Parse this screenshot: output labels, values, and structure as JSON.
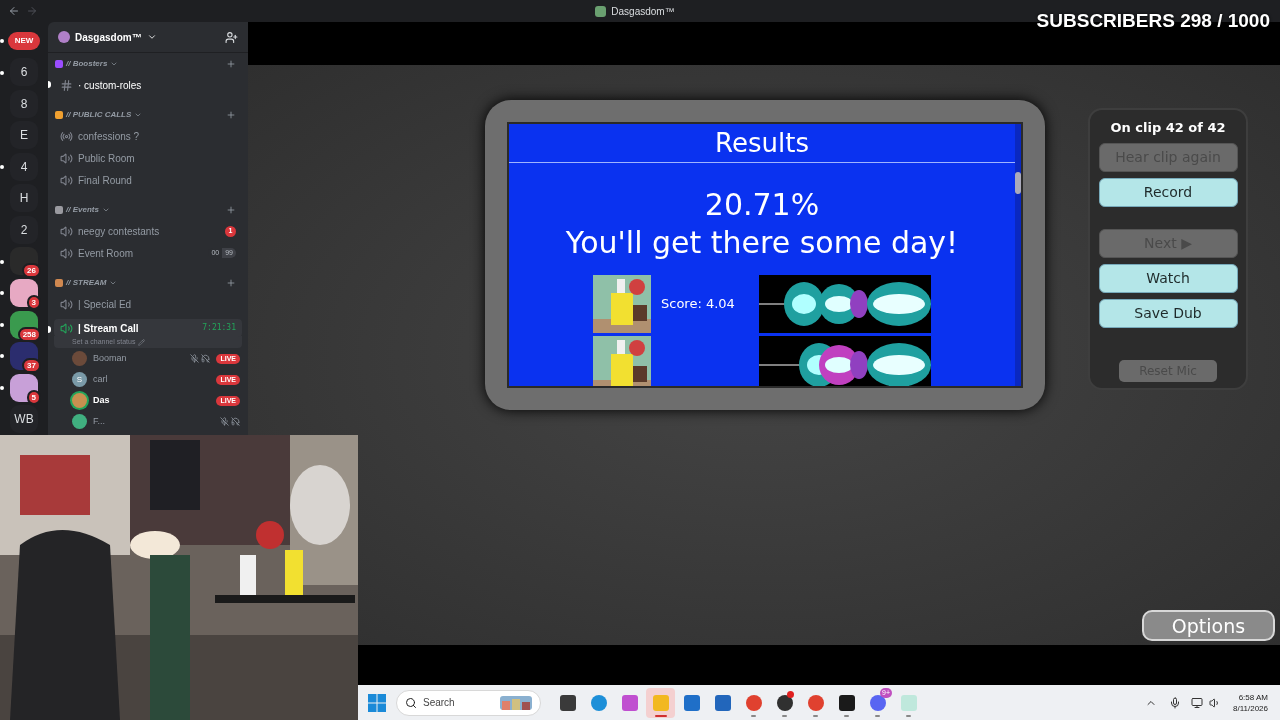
{
  "window": {
    "title": "Dasgasdom™"
  },
  "overlay": {
    "subscribers": "SUBSCRIBERS 298 / 1000"
  },
  "servers": [
    {
      "kind": "pill",
      "label": "NEW",
      "unread": true
    },
    {
      "kind": "letter",
      "label": "6",
      "unread": true
    },
    {
      "kind": "letter",
      "label": "8",
      "unread": false
    },
    {
      "kind": "letter",
      "label": "E",
      "unread": false
    },
    {
      "kind": "letter",
      "label": "4",
      "unread": true
    },
    {
      "kind": "letter",
      "label": "H",
      "unread": false
    },
    {
      "kind": "letter",
      "label": "2",
      "unread": false
    },
    {
      "kind": "avatar",
      "count": "26",
      "color": "#2a2a2a",
      "unread": true
    },
    {
      "kind": "avatar",
      "count": "3",
      "color": "#e7a9c3",
      "unread": true
    },
    {
      "kind": "avatar",
      "count": "258",
      "color": "#3a9a4e",
      "unread": true
    },
    {
      "kind": "avatar",
      "count": "37",
      "color": "#2b2d6e",
      "unread": true
    },
    {
      "kind": "avatar",
      "count": "5",
      "color": "#c8a0d8",
      "unread": true
    },
    {
      "kind": "letter",
      "label": "WB",
      "unread": false
    }
  ],
  "channel_list": {
    "server_name": "Dasgasdom™",
    "categories": [
      {
        "name": "// Boosters",
        "color": "#9b4dff",
        "channels": [
          {
            "kind": "text",
            "name": "· custom-roles",
            "unread": true,
            "selected": false
          }
        ]
      },
      {
        "name": "// PUBLIC CALLS",
        "color": "#f0a030",
        "channels": [
          {
            "kind": "stage",
            "name": "confessions ?",
            "unread": false,
            "selected": false
          },
          {
            "kind": "voice",
            "name": "Public Room",
            "unread": false,
            "selected": false
          },
          {
            "kind": "voice",
            "name": "Final Round",
            "unread": false,
            "selected": false
          }
        ]
      },
      {
        "name": "// Events",
        "color": "#9a9aa0",
        "channels": [
          {
            "kind": "voice",
            "name": "neegy contestants",
            "badge": "1",
            "unread": false,
            "selected": false
          },
          {
            "kind": "voice",
            "name": "Event Room",
            "limit": [
              "00",
              "99"
            ],
            "unread": false,
            "selected": false
          }
        ]
      },
      {
        "name": "// STREAM",
        "color": "#d08850",
        "channels": [
          {
            "kind": "voice",
            "name": "| Special Ed",
            "unread": false,
            "selected": false
          },
          {
            "kind": "voice",
            "name": "| Stream Call",
            "timer": "7:21:31",
            "status": "Set a channel status",
            "unread": true,
            "selected": true,
            "members": [
              {
                "name": "Booman",
                "color": "#6b4a3a",
                "badge": "LIVE",
                "muted": true,
                "speaking": false
              },
              {
                "name": "carl",
                "color": "#7a9aa8",
                "letter": "S",
                "badge": "LIVE",
                "muted": false,
                "speaking": false
              },
              {
                "name": "Das",
                "color": "#c89050",
                "badge": "LIVE",
                "muted": false,
                "speaking": true
              },
              {
                "name": "F...",
                "color": "#40b080",
                "muted": true,
                "speaking": false
              }
            ]
          }
        ]
      }
    ]
  },
  "results": {
    "title": "Results",
    "score": "20.71%",
    "message": "You'll get there some day!",
    "clips": [
      {
        "kind": "scored",
        "score": "Score: 4.04"
      },
      {
        "kind": "partial"
      }
    ]
  },
  "controls": {
    "clip_counter": "On clip 42 of 42",
    "button_groups": [
      [
        {
          "label": "Hear clip again",
          "disabled": true
        },
        {
          "label": "Record",
          "disabled": false
        }
      ],
      [
        {
          "label": "Next ▶",
          "disabled": true
        },
        {
          "label": "Watch",
          "disabled": false
        },
        {
          "label": "Save Dub",
          "disabled": false
        }
      ]
    ],
    "reset": {
      "label": "Reset Mic",
      "disabled": true
    }
  },
  "options_button": "Options",
  "taskbar": {
    "search": {
      "placeholder": "Search"
    },
    "apps": [
      {
        "kind": "square",
        "color": "#3a3a3a",
        "running": false,
        "selected": false
      },
      {
        "kind": "circle",
        "color": "#1d8fd8",
        "running": false,
        "selected": false
      },
      {
        "kind": "square",
        "color": "#c04fd0",
        "running": false,
        "selected": false
      },
      {
        "kind": "square",
        "color": "#f2b820",
        "running": true,
        "selected": true
      },
      {
        "kind": "square",
        "color": "#1f6fc8",
        "running": false,
        "selected": false
      },
      {
        "kind": "square",
        "color": "#2266bb",
        "running": false,
        "selected": false
      },
      {
        "kind": "circle",
        "color": "#e0412f",
        "running": true,
        "selected": false
      },
      {
        "kind": "circle",
        "color": "#303030",
        "running": true,
        "selected": false,
        "notify": true
      },
      {
        "kind": "circle",
        "color": "#e0412f",
        "running": true,
        "selected": false
      },
      {
        "kind": "square",
        "color": "#1a1a1a",
        "running": true,
        "selected": false
      },
      {
        "kind": "circle",
        "color": "#5865f2",
        "running": true,
        "selected": false,
        "badge": "9+"
      },
      {
        "kind": "square",
        "color": "#bfe8dc",
        "running": true,
        "selected": false
      }
    ],
    "time": "6:58 AM",
    "date": "8/11/2026"
  }
}
